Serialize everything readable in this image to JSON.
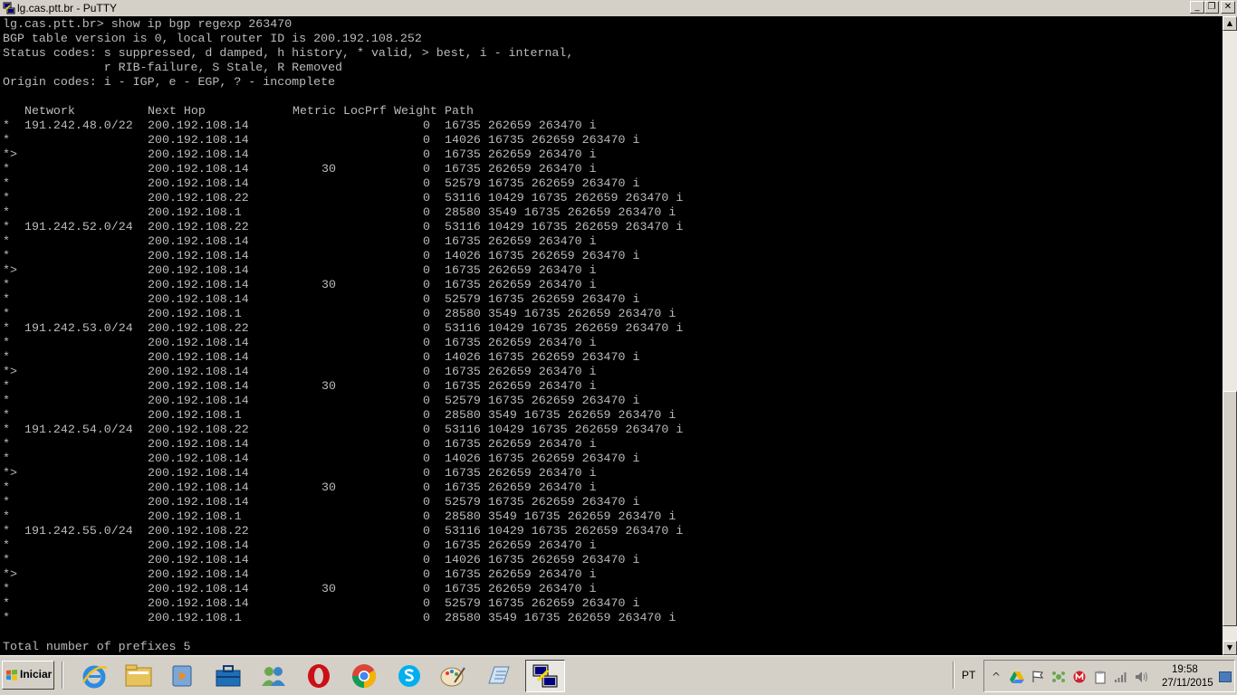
{
  "window": {
    "title": "lg.cas.ptt.br - PuTTY",
    "buttons": {
      "minimize": "_",
      "maximize": "❐",
      "close": "✕"
    }
  },
  "terminal": {
    "header_lines": [
      "lg.cas.ptt.br> show ip bgp regexp 263470",
      "BGP table version is 0, local router ID is 200.192.108.252",
      "Status codes: s suppressed, d damped, h history, * valid, > best, i - internal,",
      "              r RIB-failure, S Stale, R Removed",
      "Origin codes: i - IGP, e - EGP, ? - incomplete",
      ""
    ],
    "column_headers": {
      "network": "Network",
      "next_hop": "Next Hop",
      "metric": "Metric",
      "locprf": "LocPrf",
      "weight": "Weight",
      "path": "Path"
    },
    "routes": [
      {
        "status": "*",
        "network": "191.242.48.0/22",
        "next_hop": "200.192.108.14",
        "metric": "",
        "weight": "0",
        "path": "16735 262659 263470 i"
      },
      {
        "status": "*",
        "network": "",
        "next_hop": "200.192.108.14",
        "metric": "",
        "weight": "0",
        "path": "14026 16735 262659 263470 i"
      },
      {
        "status": "*>",
        "network": "",
        "next_hop": "200.192.108.14",
        "metric": "",
        "weight": "0",
        "path": "16735 262659 263470 i"
      },
      {
        "status": "*",
        "network": "",
        "next_hop": "200.192.108.14",
        "metric": "30",
        "weight": "0",
        "path": "16735 262659 263470 i"
      },
      {
        "status": "*",
        "network": "",
        "next_hop": "200.192.108.14",
        "metric": "",
        "weight": "0",
        "path": "52579 16735 262659 263470 i"
      },
      {
        "status": "*",
        "network": "",
        "next_hop": "200.192.108.22",
        "metric": "",
        "weight": "0",
        "path": "53116 10429 16735 262659 263470 i"
      },
      {
        "status": "*",
        "network": "",
        "next_hop": "200.192.108.1",
        "metric": "",
        "weight": "0",
        "path": "28580 3549 16735 262659 263470 i"
      },
      {
        "status": "*",
        "network": "191.242.52.0/24",
        "next_hop": "200.192.108.22",
        "metric": "",
        "weight": "0",
        "path": "53116 10429 16735 262659 263470 i"
      },
      {
        "status": "*",
        "network": "",
        "next_hop": "200.192.108.14",
        "metric": "",
        "weight": "0",
        "path": "16735 262659 263470 i"
      },
      {
        "status": "*",
        "network": "",
        "next_hop": "200.192.108.14",
        "metric": "",
        "weight": "0",
        "path": "14026 16735 262659 263470 i"
      },
      {
        "status": "*>",
        "network": "",
        "next_hop": "200.192.108.14",
        "metric": "",
        "weight": "0",
        "path": "16735 262659 263470 i"
      },
      {
        "status": "*",
        "network": "",
        "next_hop": "200.192.108.14",
        "metric": "30",
        "weight": "0",
        "path": "16735 262659 263470 i"
      },
      {
        "status": "*",
        "network": "",
        "next_hop": "200.192.108.14",
        "metric": "",
        "weight": "0",
        "path": "52579 16735 262659 263470 i"
      },
      {
        "status": "*",
        "network": "",
        "next_hop": "200.192.108.1",
        "metric": "",
        "weight": "0",
        "path": "28580 3549 16735 262659 263470 i"
      },
      {
        "status": "*",
        "network": "191.242.53.0/24",
        "next_hop": "200.192.108.22",
        "metric": "",
        "weight": "0",
        "path": "53116 10429 16735 262659 263470 i"
      },
      {
        "status": "*",
        "network": "",
        "next_hop": "200.192.108.14",
        "metric": "",
        "weight": "0",
        "path": "16735 262659 263470 i"
      },
      {
        "status": "*",
        "network": "",
        "next_hop": "200.192.108.14",
        "metric": "",
        "weight": "0",
        "path": "14026 16735 262659 263470 i"
      },
      {
        "status": "*>",
        "network": "",
        "next_hop": "200.192.108.14",
        "metric": "",
        "weight": "0",
        "path": "16735 262659 263470 i"
      },
      {
        "status": "*",
        "network": "",
        "next_hop": "200.192.108.14",
        "metric": "30",
        "weight": "0",
        "path": "16735 262659 263470 i"
      },
      {
        "status": "*",
        "network": "",
        "next_hop": "200.192.108.14",
        "metric": "",
        "weight": "0",
        "path": "52579 16735 262659 263470 i"
      },
      {
        "status": "*",
        "network": "",
        "next_hop": "200.192.108.1",
        "metric": "",
        "weight": "0",
        "path": "28580 3549 16735 262659 263470 i"
      },
      {
        "status": "*",
        "network": "191.242.54.0/24",
        "next_hop": "200.192.108.22",
        "metric": "",
        "weight": "0",
        "path": "53116 10429 16735 262659 263470 i"
      },
      {
        "status": "*",
        "network": "",
        "next_hop": "200.192.108.14",
        "metric": "",
        "weight": "0",
        "path": "16735 262659 263470 i"
      },
      {
        "status": "*",
        "network": "",
        "next_hop": "200.192.108.14",
        "metric": "",
        "weight": "0",
        "path": "14026 16735 262659 263470 i"
      },
      {
        "status": "*>",
        "network": "",
        "next_hop": "200.192.108.14",
        "metric": "",
        "weight": "0",
        "path": "16735 262659 263470 i"
      },
      {
        "status": "*",
        "network": "",
        "next_hop": "200.192.108.14",
        "metric": "30",
        "weight": "0",
        "path": "16735 262659 263470 i"
      },
      {
        "status": "*",
        "network": "",
        "next_hop": "200.192.108.14",
        "metric": "",
        "weight": "0",
        "path": "52579 16735 262659 263470 i"
      },
      {
        "status": "*",
        "network": "",
        "next_hop": "200.192.108.1",
        "metric": "",
        "weight": "0",
        "path": "28580 3549 16735 262659 263470 i"
      },
      {
        "status": "*",
        "network": "191.242.55.0/24",
        "next_hop": "200.192.108.22",
        "metric": "",
        "weight": "0",
        "path": "53116 10429 16735 262659 263470 i"
      },
      {
        "status": "*",
        "network": "",
        "next_hop": "200.192.108.14",
        "metric": "",
        "weight": "0",
        "path": "16735 262659 263470 i"
      },
      {
        "status": "*",
        "network": "",
        "next_hop": "200.192.108.14",
        "metric": "",
        "weight": "0",
        "path": "14026 16735 262659 263470 i"
      },
      {
        "status": "*>",
        "network": "",
        "next_hop": "200.192.108.14",
        "metric": "",
        "weight": "0",
        "path": "16735 262659 263470 i"
      },
      {
        "status": "*",
        "network": "",
        "next_hop": "200.192.108.14",
        "metric": "30",
        "weight": "0",
        "path": "16735 262659 263470 i"
      },
      {
        "status": "*",
        "network": "",
        "next_hop": "200.192.108.14",
        "metric": "",
        "weight": "0",
        "path": "52579 16735 262659 263470 i"
      },
      {
        "status": "*",
        "network": "",
        "next_hop": "200.192.108.1",
        "metric": "",
        "weight": "0",
        "path": "28580 3549 16735 262659 263470 i"
      }
    ],
    "footer": "Total number of prefixes 5"
  },
  "taskbar": {
    "start_label": "Iniciar",
    "apps": [
      {
        "name": "internet-explorer-icon"
      },
      {
        "name": "file-explorer-icon"
      },
      {
        "name": "media-player-icon"
      },
      {
        "name": "toolbox-icon"
      },
      {
        "name": "users-icon"
      },
      {
        "name": "opera-icon"
      },
      {
        "name": "chrome-icon"
      },
      {
        "name": "skype-icon"
      },
      {
        "name": "paint-icon"
      },
      {
        "name": "notepad-icon"
      },
      {
        "name": "putty-icon",
        "active": true
      }
    ],
    "language": "PT",
    "clock_time": "19:58",
    "clock_date": "27/11/2015"
  },
  "colors": {
    "terminal_bg": "#000000",
    "terminal_fg": "#bbbbbb",
    "chrome": "#d4d0c8"
  }
}
